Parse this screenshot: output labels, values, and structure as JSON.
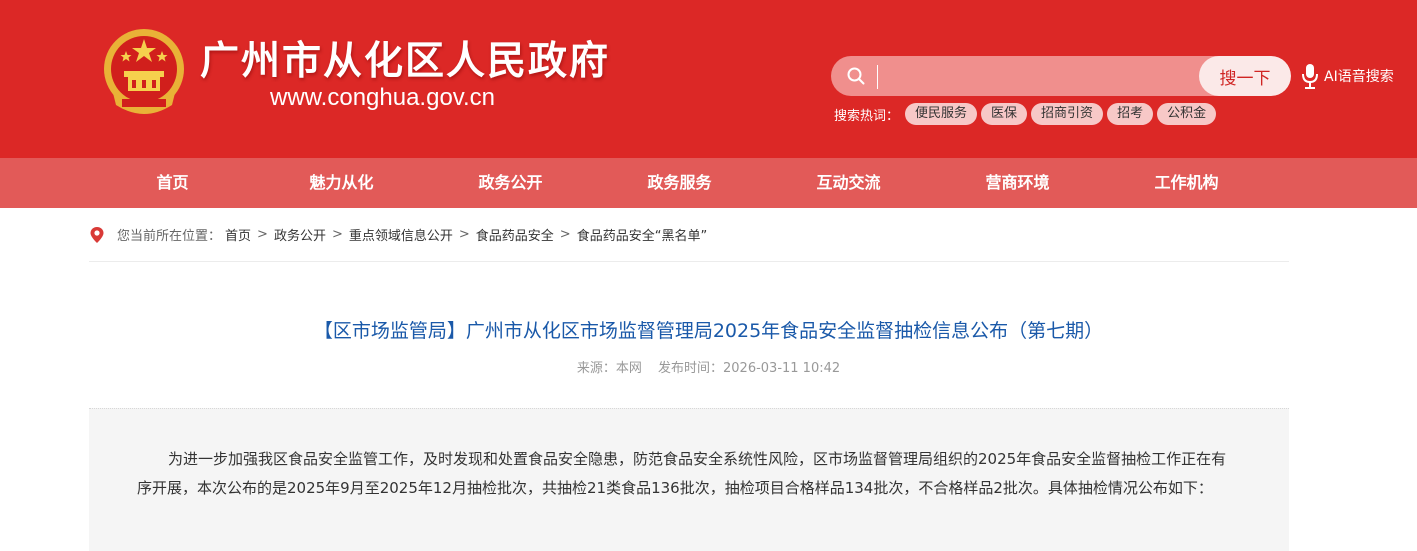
{
  "header": {
    "site_name": "广州市从化区人民政府",
    "site_url": "www.conghua.gov.cn",
    "search": {
      "placeholder": "",
      "button_label": "搜一下"
    },
    "voice_search_label": "AI语音搜索",
    "hot_search_label": "搜索热词：",
    "hot_tags": [
      "便民服务",
      "医保",
      "招商引资",
      "招考",
      "公积金"
    ]
  },
  "nav": [
    "首页",
    "魅力从化",
    "政务公开",
    "政务服务",
    "互动交流",
    "营商环境",
    "工作机构"
  ],
  "breadcrumb": {
    "prefix": "您当前所在位置：",
    "items": [
      "首页",
      "政务公开",
      "重点领域信息公开",
      "食品药品安全",
      "食品药品安全“黑名单”"
    ],
    "separator": ">"
  },
  "article": {
    "title": "【区市场监管局】广州市从化区市场监督管理局2025年食品安全监督抽检信息公布（第七期）",
    "source": "来源：本网",
    "publish_time": "发布时间：2026-03-11 10:42",
    "paragraph": "为进一步加强我区食品安全监管工作，及时发现和处置食品安全隐患，防范食品安全系统性风险，区市场监督管理局组织的2025年食品安全监督抽检工作正在有序开展，本次公布的是2025年9月至2025年12月抽检批次，共抽检21类食品136批次，抽检项目合格样品134批次，不合格样品2批次。具体抽检情况公布如下："
  },
  "colors": {
    "header_red": "#dc2826",
    "nav_red": "#e25a58",
    "title_blue": "#1a59a9"
  }
}
